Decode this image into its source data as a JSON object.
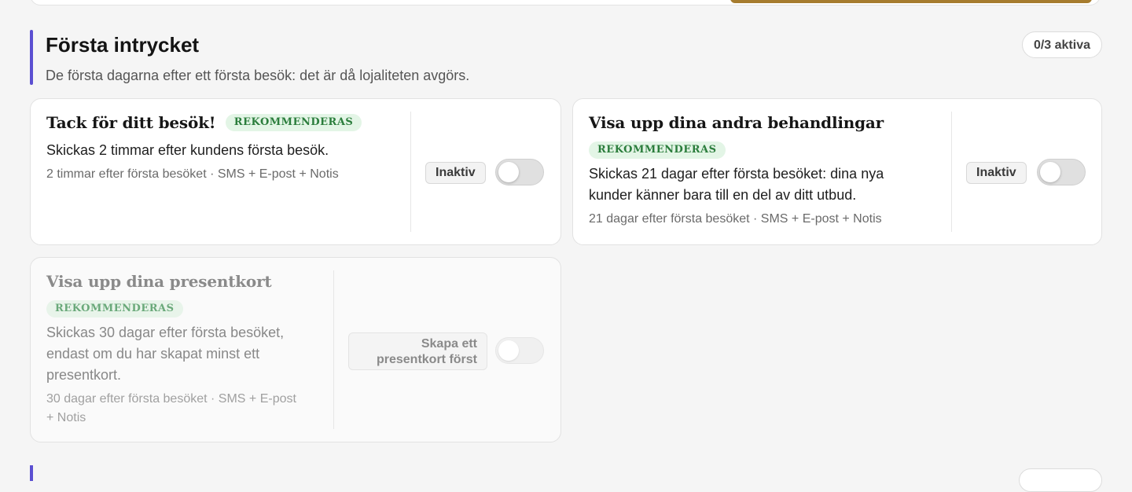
{
  "section": {
    "title": "Första intrycket",
    "subtitle": "De första dagarna efter ett första besök: det är då lojaliteten avgörs.",
    "active_count": "0/3 aktiva"
  },
  "cards": [
    {
      "title": "Tack för ditt besök!",
      "badge": "REKOMMENDERAS",
      "description": "Skickas 2 timmar efter kundens första besök.",
      "meta": "2 timmar efter första besöket · SMS + E-post + Notis",
      "status": "Inaktiv",
      "enabled": false
    },
    {
      "title": "Visa upp dina andra behandlingar",
      "badge": "REKOMMENDERAS",
      "description_line1": "Skickas 21 dagar efter första besöket: dina nya",
      "description_line2": "kunder känner bara till en del av ditt utbud.",
      "meta": "21 dagar efter första besöket · SMS + E-post + Notis",
      "status": "Inaktiv",
      "enabled": false
    },
    {
      "title": "Visa upp dina presentkort",
      "badge": "REKOMMENDERAS",
      "description_line1": "Skickas 30 dagar efter första besöket,",
      "description_line2": "endast om du har skapat minst ett",
      "description_line3": "presentkort.",
      "meta_line1": "30 dagar efter första besöket · SMS + E-post",
      "meta_line2": "+ Notis",
      "status_line1": "Skapa ett",
      "status_line2": "presentkort först",
      "enabled": false,
      "disabled": true
    }
  ],
  "colors": {
    "accent": "#5b4fd1",
    "recommend_badge_bg": "#e3f5e6",
    "recommend_badge_text": "#2b7d3c",
    "gold": "#a67c2e"
  }
}
